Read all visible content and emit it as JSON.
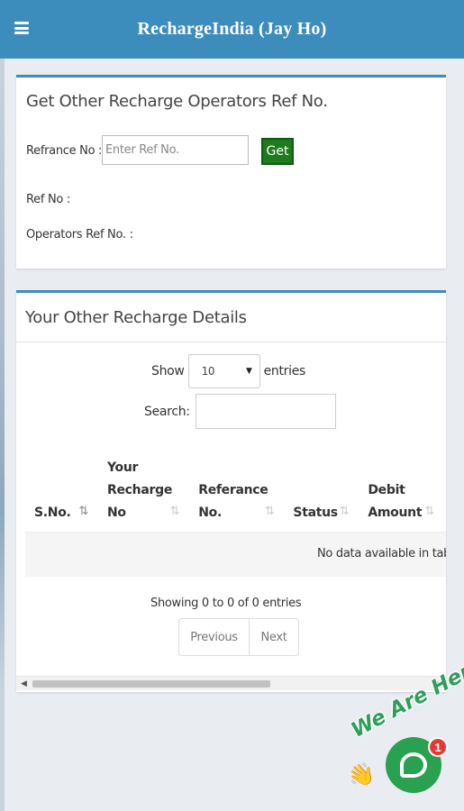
{
  "header": {
    "title": "RechargeIndia (Jay Ho)",
    "menu_icon": "hamburger-menu-icon"
  },
  "ref_lookup": {
    "title": "Get Other Recharge Operators Ref No.",
    "refrance_label": "Refrance No :",
    "input_placeholder": "Enter Ref No.",
    "input_value": "",
    "get_button": "Get",
    "ref_no_label": "Ref No :",
    "operators_ref_label": "Operators Ref No. :"
  },
  "details": {
    "title": "Your Other Recharge Details",
    "show_label": "Show",
    "page_length": "10",
    "entries_label": "entries",
    "search_label": "Search:",
    "search_value": "",
    "columns": [
      {
        "label": "S.No.",
        "sort": "asc"
      },
      {
        "label": "Your Recharge No",
        "sort": "none"
      },
      {
        "label": "Referance No.",
        "sort": "none"
      },
      {
        "label": "Status",
        "sort": "none"
      },
      {
        "label": "Debit Amount",
        "sort": "none"
      }
    ],
    "empty_message": "No data available in table",
    "info": "Showing 0 to 0 of 0 entries",
    "previous": "Previous",
    "next": "Next"
  },
  "chat": {
    "badge_text": "We Are Here!",
    "unread_count": "1",
    "wave_icon": "waving-hand-icon",
    "chat_icon": "chat-bubble-icon"
  },
  "colors": {
    "header": "#3c8dbc",
    "get_button": "#1d7a1d",
    "chat": "#29a150",
    "badge": "#e53935"
  }
}
